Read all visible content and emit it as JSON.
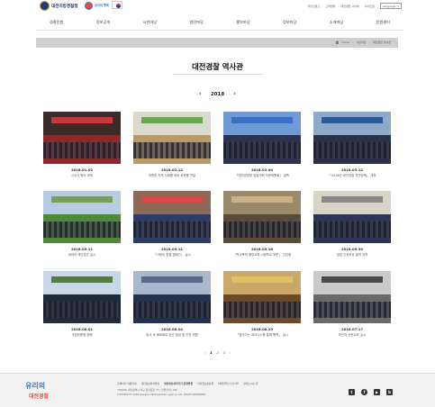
{
  "header": {
    "logo_text": "대전지방경찰청",
    "sub_logo_text": "유리의 행복",
    "utility_links": [
      "국민신문고",
      "고객센터",
      "대전경찰 사이버",
      "사이트맵"
    ],
    "language_label": "Language"
  },
  "nav": {
    "items": [
      "경찰민원",
      "정보공개",
      "시민마당",
      "열린마당",
      "홍보마당",
      "정보마당",
      "소개마당",
      "민원센터"
    ]
  },
  "breadcrumb": {
    "items": [
      "Home",
      "시민마당",
      "대전경찰 역사관"
    ]
  },
  "page": {
    "title": "대전경찰 역사관",
    "year": "2018",
    "prev_arrow": "‹",
    "next_arrow": "›"
  },
  "gallery": [
    {
      "date": "2018.01.02",
      "caption": "시무식 행사 개최",
      "palette": {
        "sky": "#3a2a2a",
        "ground": "#8b2a2a",
        "banner": "#c43a3a"
      }
    },
    {
      "date": "2018.02.12",
      "caption": "따뜻한 지역 사회를 위한 위문품 전달",
      "palette": {
        "sky": "#d9d9d0",
        "ground": "#b99a6a",
        "banner": "#6aa84f"
      }
    },
    {
      "date": "2018.03.09",
      "caption": "「대전경찰청 경찰개혁 자문위원회」 발족",
      "palette": {
        "sky": "#6f9ad6",
        "ground": "#2b3350",
        "banner": "#3b6fc2"
      }
    },
    {
      "date": "2018.03.12",
      "caption": "「2018년 대전경찰 치안정책」 개최",
      "palette": {
        "sky": "#8fa9c9",
        "ground": "#2a3248",
        "banner": "#2a5a9a"
      }
    },
    {
      "date": "2018.05.11",
      "caption": "대테러·재난훈련 실시",
      "palette": {
        "sky": "#b7cbe3",
        "ground": "#4f8a3a",
        "banner": "#7a9e62"
      }
    },
    {
      "date": "2018.05.11",
      "caption": "「사랑의 헌혈 캠페인」 실시",
      "palette": {
        "sky": "#8c6a5a",
        "ground": "#2c3d66",
        "banner": "#d94a4a"
      }
    },
    {
      "date": "2018.05.16",
      "caption": "「학교폭력 예방교육 시범학교 위문」 간담회",
      "palette": {
        "sky": "#9a8a6a",
        "ground": "#5a4a3a",
        "banner": "#c9b28a"
      }
    },
    {
      "date": "2018.05.30",
      "caption": "경찰 인권보호 결의 개최",
      "palette": {
        "sky": "#d9d4c8",
        "ground": "#2b3556",
        "banner": "#8a8a8a"
      }
    },
    {
      "date": "2018.06.01",
      "caption": "국립현충원 참배",
      "palette": {
        "sky": "#c9d6e6",
        "ground": "#1f2a3a",
        "banner": "#4f7f3a"
      }
    },
    {
      "date": "2018.06.04",
      "caption": "등교 후 폐쇄회로 공간 점검 및 안전 체험",
      "palette": {
        "sky": "#a9b8cc",
        "ground": "#24314f",
        "banner": "#596a8a"
      }
    },
    {
      "date": "2018.06.29",
      "caption": "「찾아가는 레크니스를 통해 행복」 실시",
      "palette": {
        "sky": "#c9a86a",
        "ground": "#6a4a2a",
        "banner": "#e0c060"
      }
    },
    {
      "date": "2018.07.17",
      "caption": "보안자 전문교육 실시",
      "palette": {
        "sky": "#c9c9c9",
        "ground": "#6a6a6a",
        "banner": "#4a4a4a"
      }
    }
  ],
  "pagination": {
    "prev": "‹",
    "pages": [
      "1",
      "2",
      "3"
    ],
    "current": "1",
    "next": "›"
  },
  "footer": {
    "logo_line1": "유리의",
    "logo_line2": "대전경찰",
    "links": [
      "홈페이지 이용안내",
      "개인정보처리방침",
      "영상정보처리기기 운영방침",
      "저작권보호정책",
      "이메일무단수집거부",
      "찾아오시는 길"
    ],
    "address": "(35226) 대전광역시 서구 둔산중로 77 | 민원안내: 182",
    "copyright": "COPYRIGHT 2018 Daejeon Metropolitan Agency. ALL RIGHT RESERVED",
    "social": [
      "twitter-icon",
      "facebook-icon",
      "youtube-icon",
      "blog-icon"
    ]
  }
}
